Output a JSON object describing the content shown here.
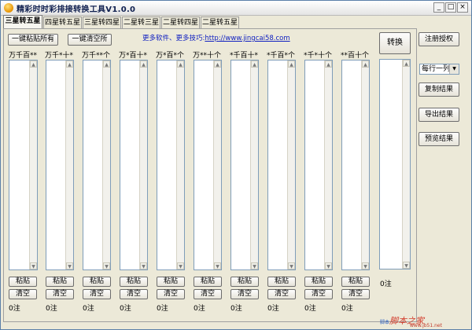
{
  "window": {
    "title": "精彩时时彩排接转换工具V1.0.0",
    "buttons": [
      "_",
      "□",
      "×"
    ]
  },
  "tabs": [
    "三星转五星",
    "四星转五星",
    "三星转四星",
    "二星转三星",
    "二星转四星",
    "二星转五星"
  ],
  "toolbar": {
    "paste_all": "一键粘贴所有",
    "clear_all": "一键清空所",
    "link_prefix": "更多软件、更多技巧:",
    "link_url": "http://www.jingcai58.com",
    "convert": "转换"
  },
  "columns": [
    {
      "label": "万千百**",
      "paste": "粘贴",
      "clear": "清空",
      "count": "0注"
    },
    {
      "label": "万千*十*",
      "paste": "粘贴",
      "clear": "清空",
      "count": "0注"
    },
    {
      "label": "万千**个",
      "paste": "粘贴",
      "clear": "清空",
      "count": "0注"
    },
    {
      "label": "万*百十*",
      "paste": "粘贴",
      "clear": "清空",
      "count": "0注"
    },
    {
      "label": "万*百*个",
      "paste": "粘贴",
      "clear": "清空",
      "count": "0注"
    },
    {
      "label": "万**十个",
      "paste": "粘贴",
      "clear": "清空",
      "count": "0注"
    },
    {
      "label": "*千百十*",
      "paste": "粘贴",
      "clear": "清空",
      "count": "0注"
    },
    {
      "label": "*千百*个",
      "paste": "粘贴",
      "clear": "清空",
      "count": "0注"
    },
    {
      "label": "*千*十个",
      "paste": "粘贴",
      "clear": "清空",
      "count": "0注"
    },
    {
      "label": "**百十个",
      "paste": "粘贴",
      "clear": "清空",
      "count": "0注"
    }
  ],
  "result": {
    "count": "0注"
  },
  "side": {
    "register": "注册授权",
    "per_line_select": "每行一列",
    "copy": "复制结果",
    "export": "导出结果",
    "preview": "预览结果"
  },
  "watermark": {
    "main": "脚本之家",
    "prefix": "脚本",
    "sub": "www.jb51.net",
    "sub_text": "www.jb51.net"
  }
}
